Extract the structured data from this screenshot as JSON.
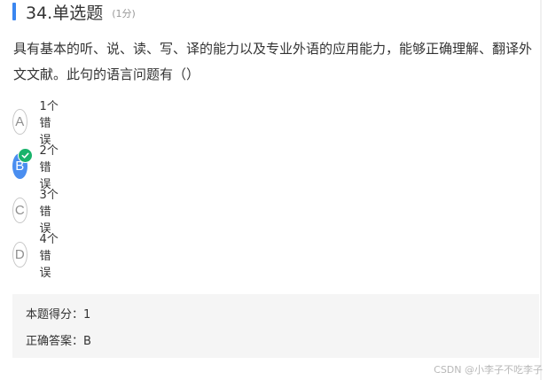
{
  "question": {
    "number_title": "34.单选题",
    "score": "(1分)",
    "text": "具有基本的听、说、读、写、译的能力以及专业外语的应用能力，能够正确理解、翻译外文文献。此句的语言问题有（）"
  },
  "options": [
    {
      "letter": "A",
      "label": "1个错误",
      "selected": false
    },
    {
      "letter": "B",
      "label": "2个错误",
      "selected": true
    },
    {
      "letter": "C",
      "label": "3个错误",
      "selected": false
    },
    {
      "letter": "D",
      "label": "4个错误",
      "selected": false
    }
  ],
  "result": {
    "score_line": "本题得分：1",
    "answer_line": "正确答案：B"
  },
  "watermark": "CSDN @小李子不吃李子",
  "colors": {
    "accent": "#3a86f0",
    "selected": "#4a8ef0",
    "correct_badge": "#19b36b"
  }
}
